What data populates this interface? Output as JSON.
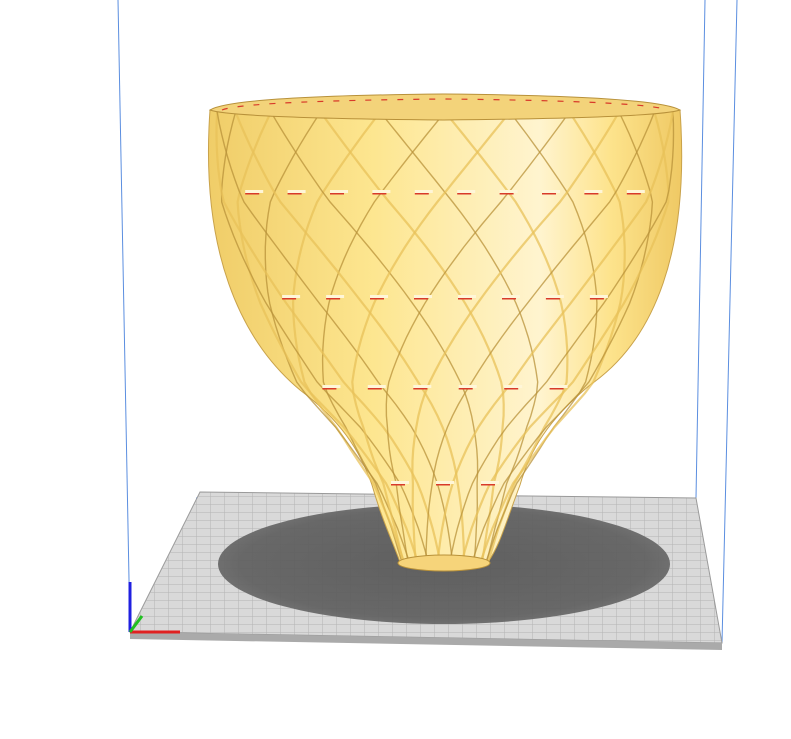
{
  "viewport": {
    "background": "#ffffff",
    "build_volume_color": "#4a7fd6",
    "plate_light": "#d8d8d8",
    "plate_grid": "#b8b8b8",
    "plate_edge": "#9a9a9a",
    "shadow_color": "#5a5a5a",
    "model_color": "#fde28a",
    "model_shade": "#e8c15a",
    "model_dark": "#b8913a",
    "model_highlight": "#fff6d8",
    "cut_color": "#d83a2a",
    "axis_x_color": "#e02020",
    "axis_y_color": "#20c020",
    "axis_z_color": "#2020e0",
    "rib_count": 22,
    "slot_rows": 4
  }
}
